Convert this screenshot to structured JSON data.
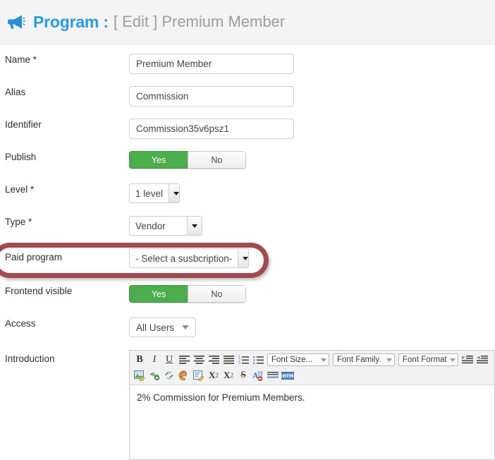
{
  "header": {
    "icon": "megaphone-icon",
    "title": "Program :",
    "subtitle": "[ Edit ] Premium Member",
    "title_color": "#2b9ae0",
    "subtitle_color": "#9d9d9d",
    "background": "#f4f4f4"
  },
  "form": {
    "name": {
      "label": "Name *",
      "value": "Premium Member",
      "placeholder": ""
    },
    "alias": {
      "label": "Alias",
      "value": "Commission",
      "placeholder": ""
    },
    "identifier": {
      "label": "Identifier",
      "value": "Commission35v6psz1",
      "placeholder": ""
    },
    "publish": {
      "label": "Publish",
      "yes": "Yes",
      "no": "No",
      "selected": "Yes"
    },
    "level": {
      "label": "Level *",
      "value": "1 level"
    },
    "type": {
      "label": "Type *",
      "value": "Vendor"
    },
    "paid_program": {
      "label": "Paid program",
      "value": "- Select a susbcription-"
    },
    "frontend_visible": {
      "label": "Frontend visible",
      "yes": "Yes",
      "no": "No",
      "selected": "Yes"
    },
    "access": {
      "label": "Access",
      "value": "All Users"
    },
    "introduction": {
      "label": "Introduction",
      "content": "2% Commission for Premium Members."
    }
  },
  "annotation": {
    "target": "paid-program-row",
    "shape": "rounded-rectangle-outline",
    "color": "#a14a4f"
  },
  "editor": {
    "toolbar_row1": [
      {
        "name": "bold-icon",
        "glyph": "B"
      },
      {
        "name": "italic-icon",
        "glyph": "I"
      },
      {
        "name": "underline-icon",
        "glyph": "U"
      },
      {
        "name": "align-left-icon",
        "glyph": ""
      },
      {
        "name": "align-center-icon",
        "glyph": ""
      },
      {
        "name": "align-right-icon",
        "glyph": ""
      },
      {
        "name": "align-justify-icon",
        "glyph": ""
      },
      {
        "name": "ordered-list-icon",
        "glyph": ""
      },
      {
        "name": "unordered-list-icon",
        "glyph": ""
      }
    ],
    "dropdowns": [
      {
        "name": "font-size-dropdown",
        "label": "Font Size..."
      },
      {
        "name": "font-family-dropdown",
        "label": "Font Family."
      },
      {
        "name": "font-format-dropdown",
        "label": "Font Format"
      }
    ],
    "toolbar_row1_end": [
      {
        "name": "outdent-icon"
      },
      {
        "name": "indent-icon"
      }
    ],
    "toolbar_row2": [
      {
        "name": "insert-image-icon"
      },
      {
        "name": "insert-link-icon"
      },
      {
        "name": "unlink-icon"
      },
      {
        "name": "text-color-icon"
      },
      {
        "name": "edit-source-icon"
      },
      {
        "name": "subscript-icon",
        "glyph": "X"
      },
      {
        "name": "superscript-icon",
        "glyph": "X"
      },
      {
        "name": "strikethrough-icon",
        "glyph": "S"
      },
      {
        "name": "remove-format-icon"
      },
      {
        "name": "horizontal-rule-icon"
      },
      {
        "name": "html-source-icon",
        "glyph": "XHTML"
      }
    ]
  }
}
